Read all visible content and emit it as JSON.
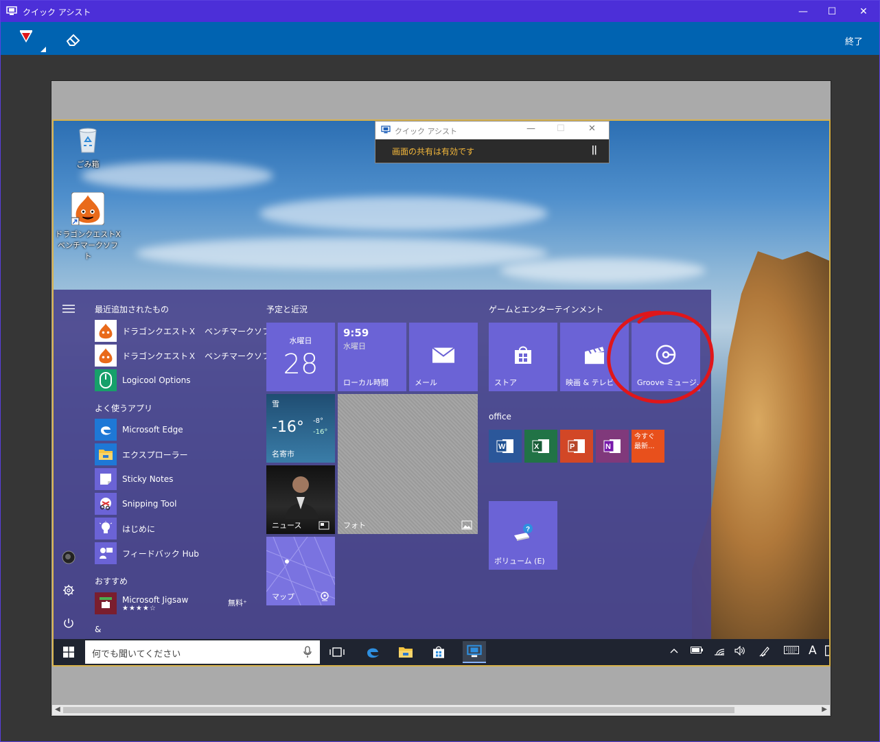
{
  "window": {
    "title": "クイック アシスト",
    "minimize": "—",
    "maximize": "☐",
    "close": "✕"
  },
  "toolbar": {
    "end_label": "終了"
  },
  "desktop": {
    "icons": [
      {
        "label": "ごみ箱"
      },
      {
        "label_line1": "ドラゴンクエストX",
        "label_line2": "ベンチマークソフト"
      }
    ]
  },
  "qa_mini": {
    "title": "クイック アシスト",
    "status": "画面の共有は有効です",
    "pause": "||"
  },
  "start_menu": {
    "recent_header": "最近追加されたもの",
    "recent": [
      {
        "name": "ドラゴンクエストＸ　ベンチマークソフト"
      },
      {
        "name": "ドラゴンクエストＸ　ベンチマークソフト・..."
      },
      {
        "name": "Logicool Options"
      }
    ],
    "frequent_header": "よく使うアプリ",
    "frequent": [
      {
        "name": "Microsoft Edge"
      },
      {
        "name": "エクスプローラー"
      },
      {
        "name": "Sticky Notes"
      },
      {
        "name": "Snipping Tool"
      },
      {
        "name": "はじめに"
      },
      {
        "name": "フィードバック Hub"
      }
    ],
    "suggested_header": "おすすめ",
    "suggested": {
      "name": "Microsoft Jigsaw",
      "price": "無料⁺",
      "rating": 4.5,
      "stars": "★★★★☆"
    },
    "amp_header": "&",
    "group1_header": "予定と近況",
    "group2_header": "ゲームとエンターテインメント",
    "group3_header": "office",
    "tiles": {
      "calendar": {
        "weekday": "水曜日",
        "day": "28"
      },
      "clock": {
        "time": "9:59",
        "weekday": "水曜日",
        "label": "ローカル時間"
      },
      "mail": {
        "label": "メール"
      },
      "weather": {
        "condition": "雪",
        "temp": "-16°",
        "hi": "-8°",
        "lo": "-16°",
        "city": "名寄市"
      },
      "photo": {
        "label": "フォト"
      },
      "news": {
        "label": "ニュース"
      },
      "maps": {
        "label": "マップ"
      },
      "store": {
        "label": "ストア"
      },
      "movies": {
        "label": "映画 & テレビ"
      },
      "groove": {
        "label": "Groove ミュージ..."
      },
      "office_try": {
        "line1": "今すぐ",
        "line2": "最新..."
      },
      "volume": {
        "label": "ボリューム (E)"
      }
    }
  },
  "taskbar": {
    "search_placeholder": "何でも聞いてください",
    "ime": "A"
  },
  "colors": {
    "titlebar": "#4c2fd8",
    "toolbar": "#0063b1",
    "tile": "#6b63d6",
    "annotation": "#e0161a",
    "status_text": "#f6b93b"
  }
}
